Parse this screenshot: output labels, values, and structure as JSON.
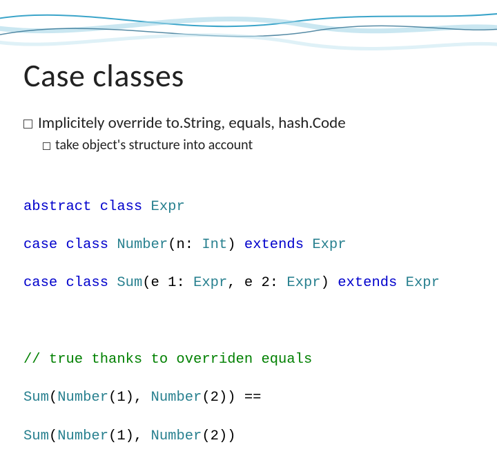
{
  "title": "Case classes",
  "bullets": {
    "b1": "Implicitely override to.String, equals, hash.Code",
    "b2": "take object's structure into account"
  },
  "code": {
    "l1": {
      "kw1": "abstract class",
      "sp1": " ",
      "t1": "Expr"
    },
    "l2": {
      "kw1": "case class",
      "sp1": " ",
      "t1": "Number",
      "p1": "(n: ",
      "t2": "Int",
      "p2": ") ",
      "kw2": "extends",
      "sp2": " ",
      "t3": "Expr"
    },
    "l3": {
      "kw1": "case class",
      "sp1": " ",
      "t1": "Sum",
      "p1": "(e 1: ",
      "t2": "Expr",
      "p2": ", e 2: ",
      "t3": "Expr",
      "p3": ") ",
      "kw2": "extends",
      "sp2": " ",
      "t4": "Expr"
    },
    "l5": {
      "cmt": "// true thanks to overriden equals"
    },
    "l6": {
      "t1": "Sum",
      "p1": "(",
      "t2": "Number",
      "p2": "(1), ",
      "t3": "Number",
      "p3": "(2)) =="
    },
    "l7": {
      "t1": "Sum",
      "p1": "(",
      "t2": "Number",
      "p2": "(1), ",
      "t3": "Number",
      "p3": "(2))"
    }
  }
}
